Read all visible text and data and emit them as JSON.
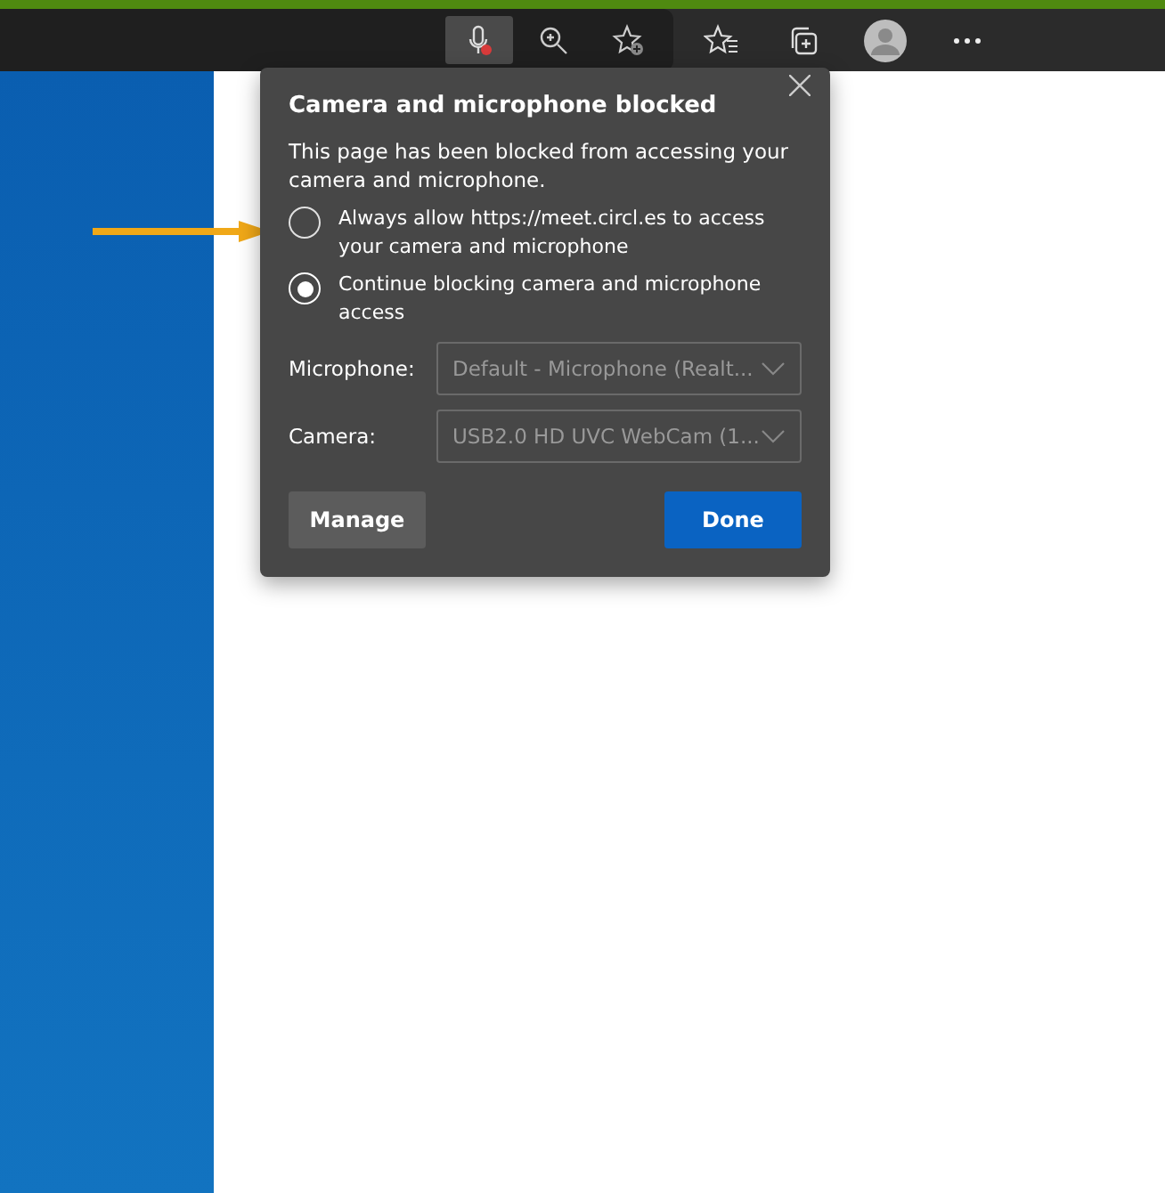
{
  "toolbar": {
    "mic_blocked": true
  },
  "dialog": {
    "title": "Camera and microphone blocked",
    "message": "This page has been blocked from accessing your camera and microphone.",
    "options": [
      {
        "label": "Always allow https://meet.circl.es to access your camera and microphone",
        "selected": false
      },
      {
        "label": "Continue blocking camera and microphone access",
        "selected": true
      }
    ],
    "fields": [
      {
        "label": "Microphone:",
        "value": "Default - Microphone (Realt...",
        "disabled": true
      },
      {
        "label": "Camera:",
        "value": "USB2.0 HD UVC WebCam (1...",
        "disabled": true
      }
    ],
    "buttons": [
      {
        "label": "Manage",
        "kind": "secondary"
      },
      {
        "label": "Done",
        "kind": "primary"
      }
    ]
  }
}
